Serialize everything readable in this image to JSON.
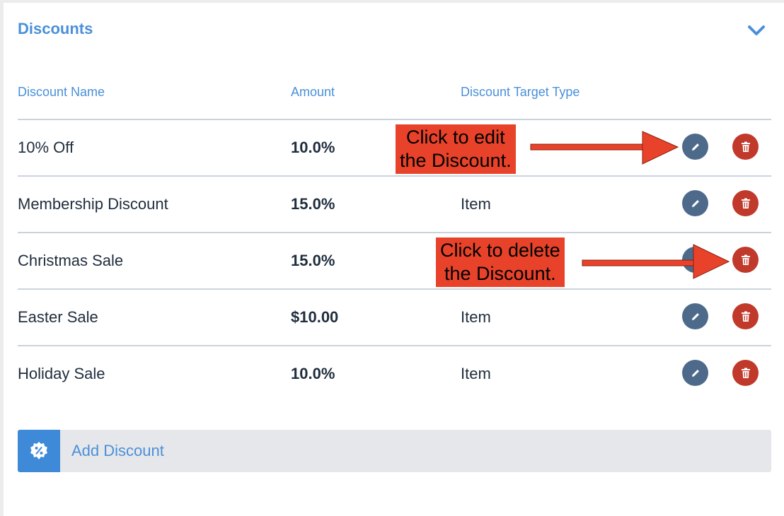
{
  "panel": {
    "title": "Discounts"
  },
  "table": {
    "headers": {
      "name": "Discount Name",
      "amount": "Amount",
      "target": "Discount Target Type"
    },
    "rows": [
      {
        "name": "10% Off",
        "amount": "10.0%",
        "target": ""
      },
      {
        "name": "Membership Discount",
        "amount": "15.0%",
        "target": "Item"
      },
      {
        "name": "Christmas Sale",
        "amount": "15.0%",
        "target": ""
      },
      {
        "name": "Easter Sale",
        "amount": "$10.00",
        "target": "Item"
      },
      {
        "name": "Holiday Sale",
        "amount": "10.0%",
        "target": "Item"
      }
    ]
  },
  "add_button": {
    "label": "Add Discount",
    "icon": "discount-badge-icon"
  },
  "annotations": {
    "edit_line1": "Click to edit",
    "edit_line2": "the Discount.",
    "delete_line1": "Click to delete",
    "delete_line2": "the Discount."
  },
  "icons": {
    "collapse": "chevron-down-icon",
    "edit": "pencil-icon",
    "delete": "trash-icon"
  },
  "colors": {
    "accent": "#4a90d9",
    "edit_button": "#4e6a8a",
    "delete_button": "#c0392b",
    "callout": "#e8432a"
  }
}
